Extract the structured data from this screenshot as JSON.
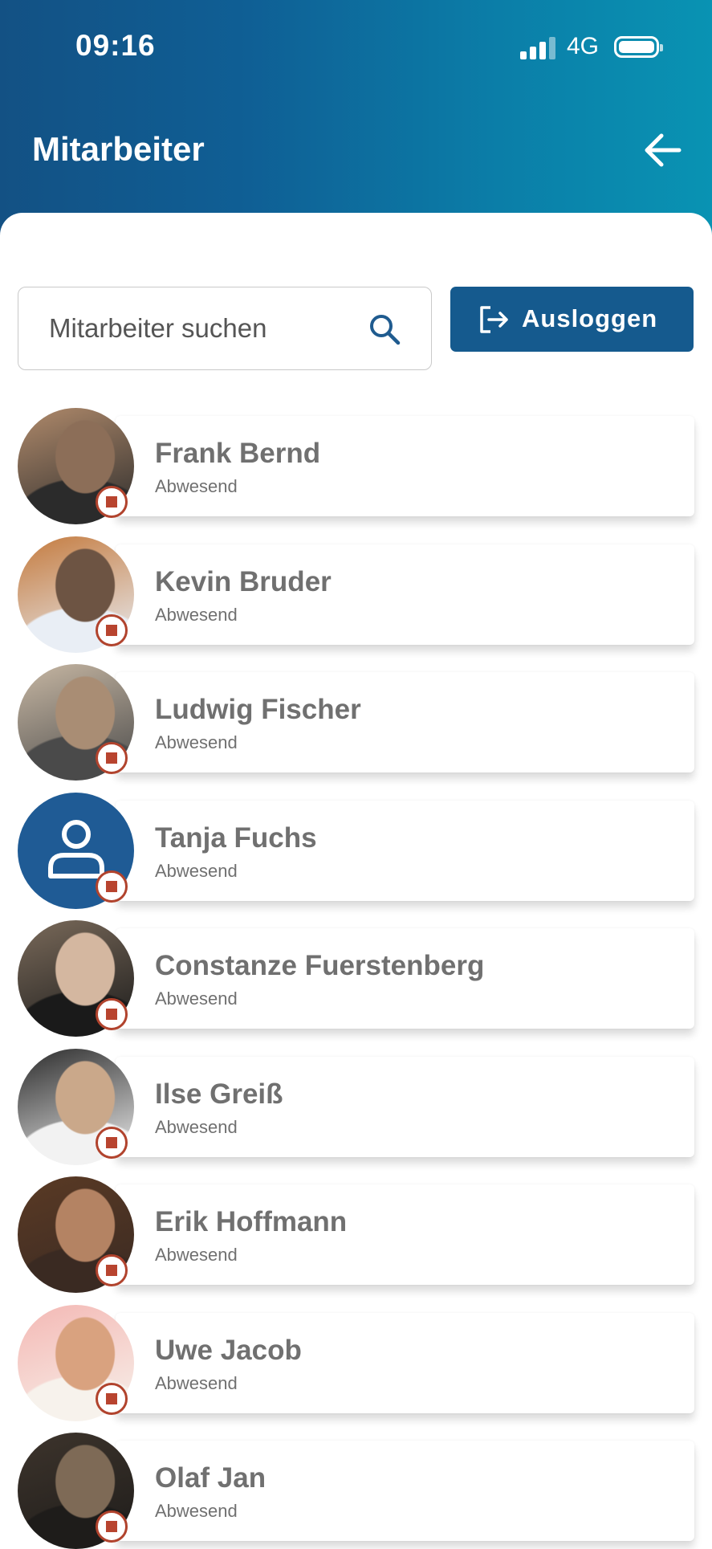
{
  "status_bar": {
    "time": "09:16",
    "network": "4G",
    "signal_icon": "cellular-signal-icon",
    "battery_icon": "battery-icon"
  },
  "header": {
    "title": "Mitarbeiter",
    "back_icon": "arrow-left-icon"
  },
  "search": {
    "placeholder": "Mitarbeiter suchen",
    "value": "",
    "icon": "search-icon"
  },
  "logout_button": {
    "label": "Ausloggen",
    "icon": "logout-icon"
  },
  "colors": {
    "header_gradient_start": "#135184",
    "header_gradient_end": "#0993b3",
    "button": "#155a8e",
    "absent_badge": "#b8442f",
    "text_gray": "#707070"
  },
  "employees": [
    {
      "name": "Frank Bernd",
      "status": "Abwesend",
      "avatar": "photo",
      "tone": [
        "#b08a6b",
        "#2b2b2b",
        "#8c6e58"
      ]
    },
    {
      "name": "Kevin Bruder",
      "status": "Abwesend",
      "avatar": "photo",
      "tone": [
        "#c47a3d",
        "#e9eef5",
        "#6d5443"
      ]
    },
    {
      "name": "Ludwig Fischer",
      "status": "Abwesend",
      "avatar": "photo",
      "tone": [
        "#c7b7a3",
        "#4a4a4a",
        "#a98d74"
      ]
    },
    {
      "name": "Tanja Fuchs",
      "status": "Abwesend",
      "avatar": "default"
    },
    {
      "name": "Constanze Fuerstenberg",
      "status": "Abwesend",
      "avatar": "photo",
      "tone": [
        "#7a6a5a",
        "#1a1a1a",
        "#d4b7a0"
      ]
    },
    {
      "name": "Ilse Greiß",
      "status": "Abwesend",
      "avatar": "photo",
      "tone": [
        "#2b2b2b",
        "#f2f2f2",
        "#caa88a"
      ]
    },
    {
      "name": "Erik Hoffmann",
      "status": "Abwesend",
      "avatar": "photo",
      "tone": [
        "#5a3a25",
        "#3a2a22",
        "#b48363"
      ]
    },
    {
      "name": "Uwe Jacob",
      "status": "Abwesend",
      "avatar": "photo",
      "tone": [
        "#f4b8b4",
        "#f7f2ec",
        "#d9a27f"
      ]
    },
    {
      "name": "Olaf Jan",
      "status": "Abwesend",
      "avatar": "photo",
      "tone": [
        "#3d342c",
        "#1e1c1a",
        "#7e6a56"
      ]
    }
  ]
}
